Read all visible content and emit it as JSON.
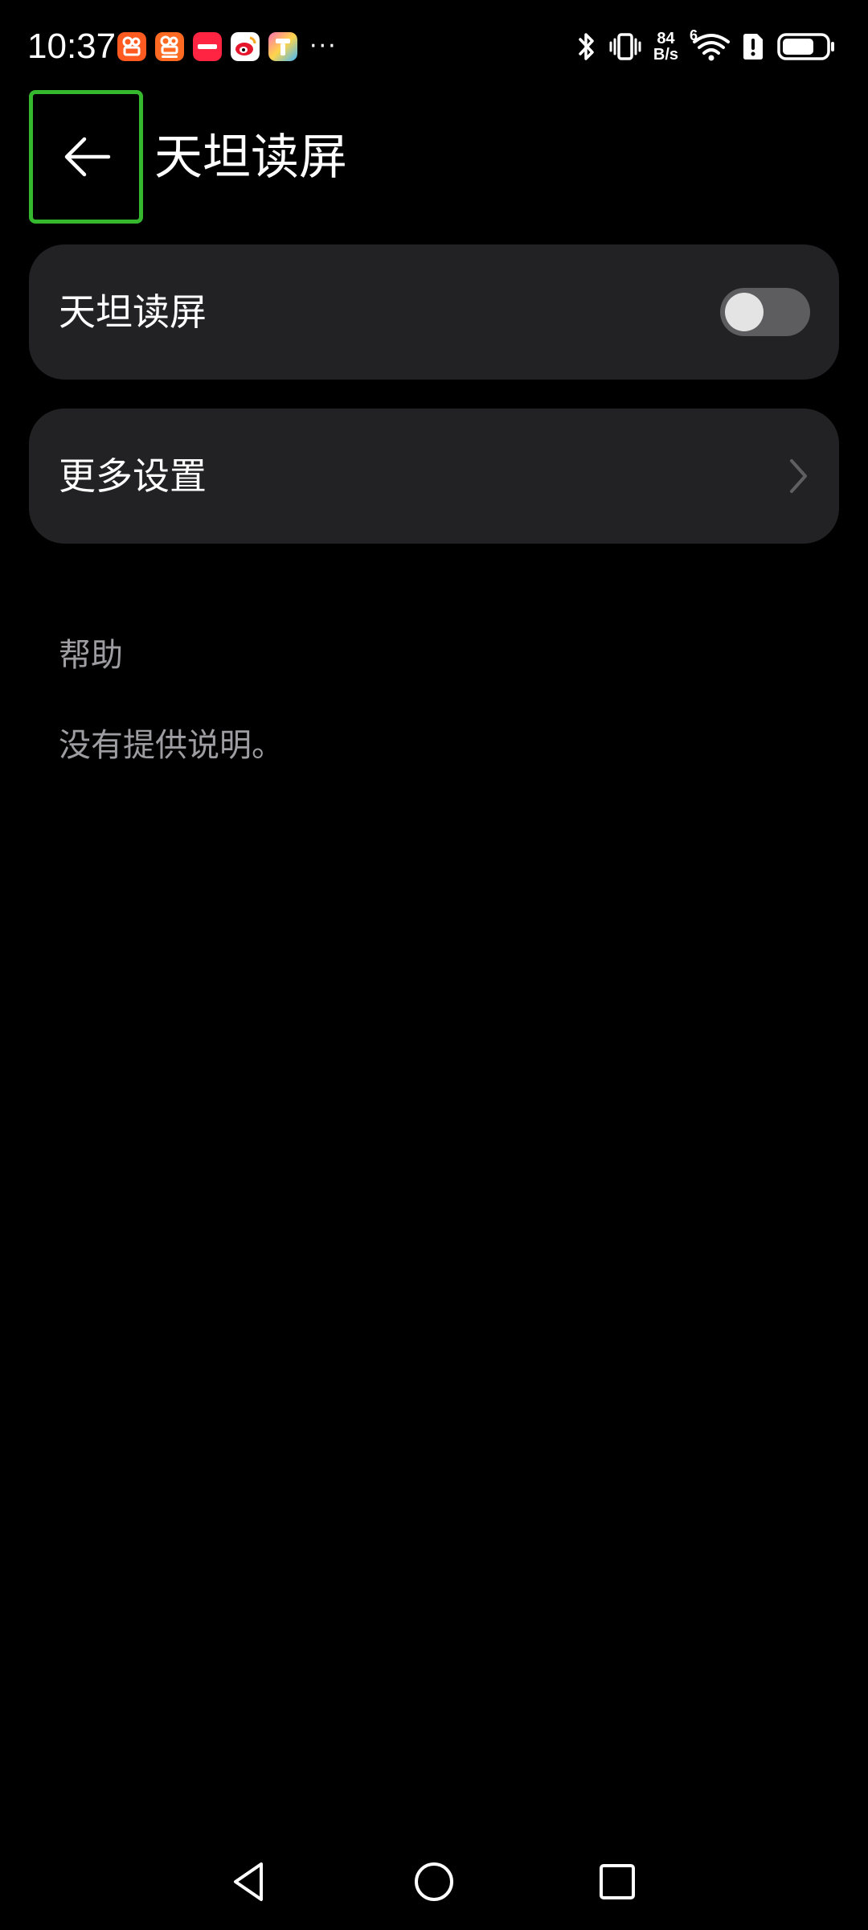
{
  "status_bar": {
    "time": "10:37",
    "notification_icons": [
      {
        "name": "kuaishou-icon",
        "color": "#ff5a1f"
      },
      {
        "name": "kuaishou-speed-icon",
        "color": "#ff6a22"
      },
      {
        "name": "xiaohongshu-icon",
        "color": "#ff2442"
      },
      {
        "name": "weibo-icon",
        "color": "#f5b400"
      },
      {
        "name": "colorful-app-icon",
        "color": "#5aa0ff"
      }
    ],
    "more_notifications": "···",
    "net_speed_value": "84",
    "net_speed_unit": "B/s",
    "wifi_badge": "6"
  },
  "header": {
    "back_icon": "arrow-left-icon",
    "title": "天坦读屏"
  },
  "settings": {
    "toggle_label": "天坦读屏",
    "toggle_on": false,
    "more_label": "更多设置"
  },
  "help": {
    "heading": "帮助",
    "body": "没有提供说明。"
  },
  "nav_bar": {
    "back": "triangle-back-icon",
    "home": "circle-home-icon",
    "recents": "square-recents-icon"
  },
  "colors": {
    "background": "#000000",
    "card": "#222224",
    "focus_border": "#36b82e",
    "switch_track_off": "#5d5d60",
    "secondary_text": "#9e9ea2"
  }
}
